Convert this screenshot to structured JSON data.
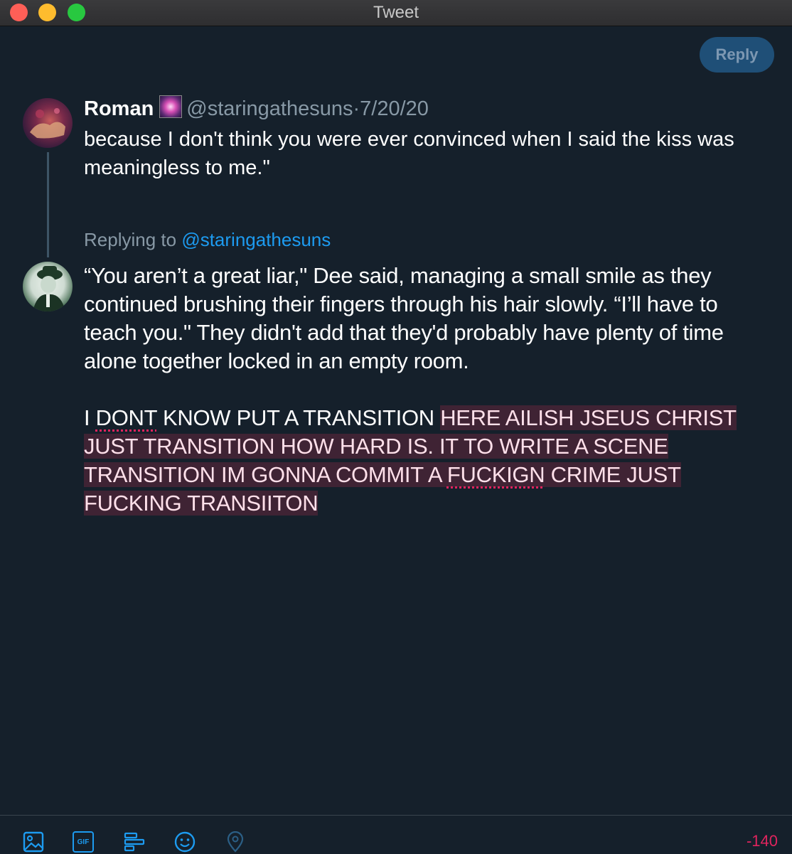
{
  "window": {
    "title": "Tweet"
  },
  "reply_button": {
    "label": "Reply"
  },
  "parent_tweet": {
    "display_name": "Roman",
    "handle": "@staringathesuns",
    "separator": "·",
    "date": "7/20/20",
    "text": "because I don't think you were ever convinced when I said the kiss was meaningless to me.\""
  },
  "replying": {
    "prefix": "Replying to",
    "mention": "@staringathesuns"
  },
  "compose": {
    "paragraph1": "“You aren’t a great liar,\" Dee said, managing a small smile as they continued brushing their fingers through his hair slowly. “I’ll have to teach you.\" They didn't add that they'd probably have plenty of time alone together locked in an empty room.",
    "p2_a": "I ",
    "p2_word1": "DONT",
    "p2_b": " KNOW PUT A TRANSITION ",
    "p2_over1": "HERE AILISH JSEUS CHRIST JUST TRANSITION HOW HARD IS. IT TO WRITE A SCENE TRANSITION IM GONNA COMMIT A ",
    "p2_word2": "FUCKIGN",
    "p2_over2": " CRIME JUST FUCKING TRANSIITON"
  },
  "toolbar": {
    "icons": [
      "image-icon",
      "gif-icon",
      "poll-icon",
      "emoji-icon",
      "location-icon"
    ],
    "gif_label": "GIF",
    "char_count": "-140"
  },
  "colors": {
    "background": "#15202b",
    "accent": "#1d9bf0",
    "over_limit": "#e0245e",
    "over_highlight": "#3f2334"
  }
}
